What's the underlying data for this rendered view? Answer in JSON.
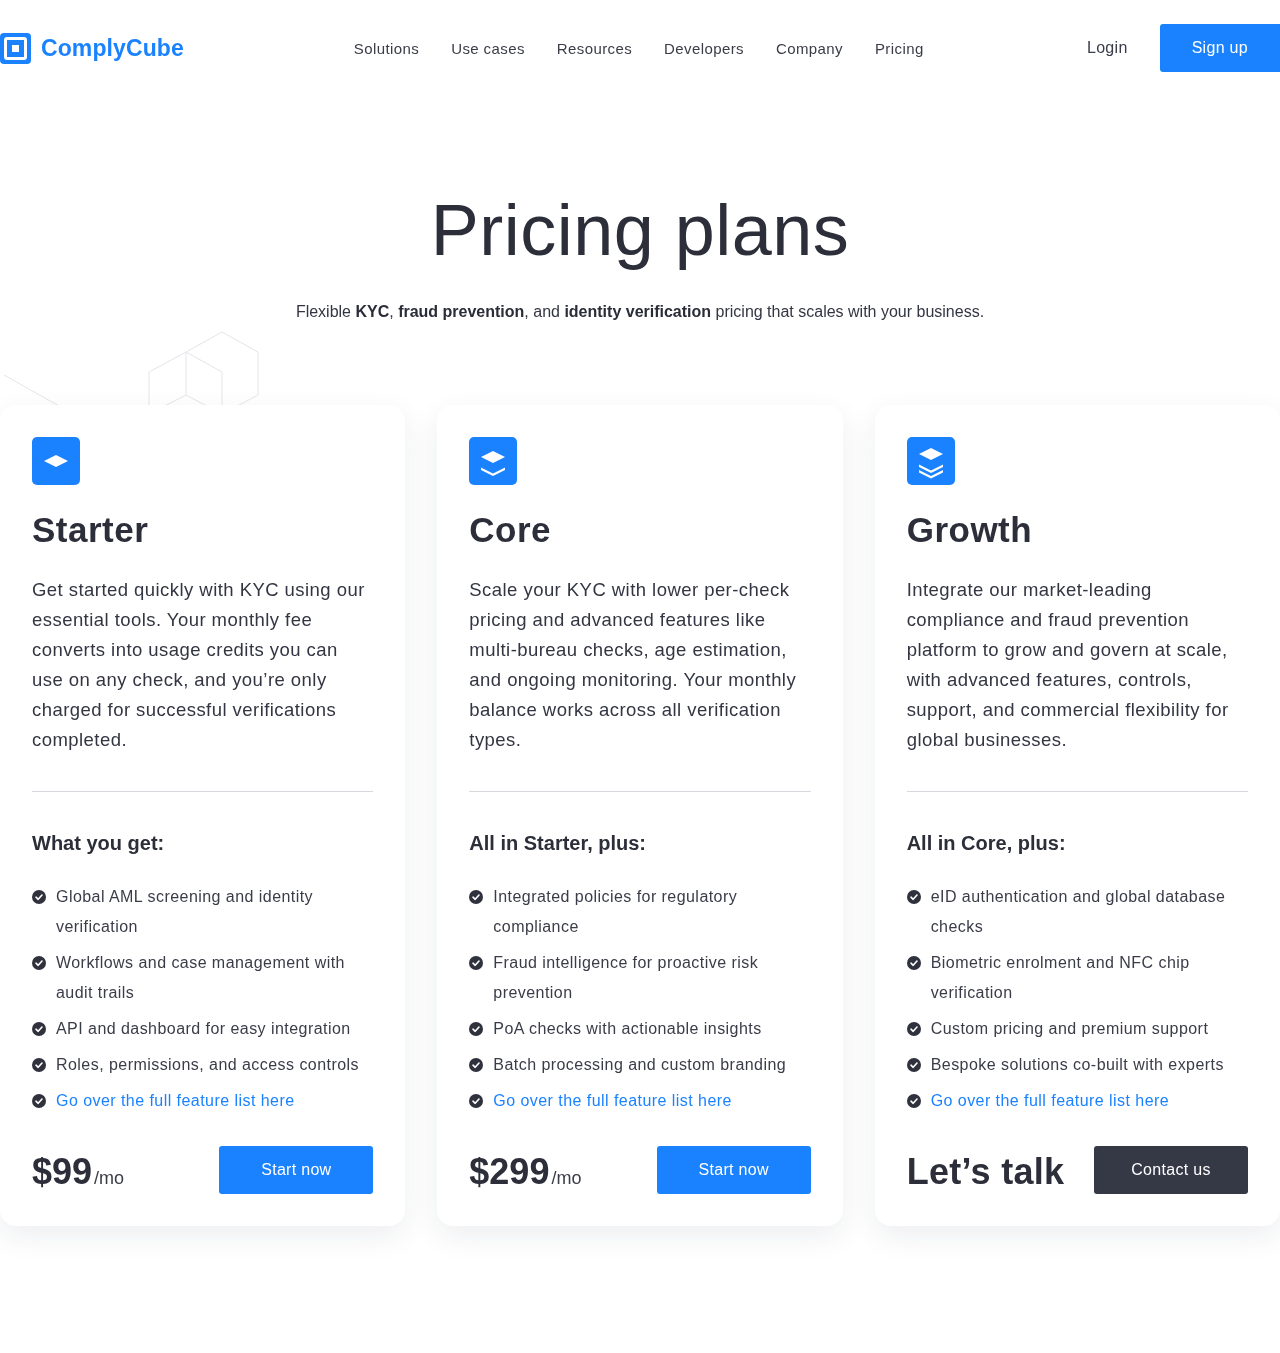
{
  "header": {
    "logo": "ComplyCube",
    "nav": [
      "Solutions",
      "Use cases",
      "Resources",
      "Developers",
      "Company",
      "Pricing"
    ],
    "login": "Login",
    "signup": "Sign up"
  },
  "hero": {
    "title": "Pricing plans",
    "subtitle": "Flexible **KYC**, **fraud prevention**, and **identity verification** pricing that scales with your business."
  },
  "plans": [
    {
      "icon": {
        "kind": "single"
      },
      "name": "Starter",
      "description": "Get started quickly with KYC using our essential tools. Your monthly fee converts into usage credits you can use on any check, and you’re only charged for successful verifications completed.",
      "features_heading": "What you get:",
      "features": [
        {
          "kind": "text",
          "text": "Global AML screening and identity verification"
        },
        {
          "kind": "text",
          "text": "Workflows and case management with audit trails"
        },
        {
          "kind": "text",
          "text": "API and dashboard for easy integration"
        },
        {
          "kind": "text",
          "text": "Roles, permissions, and access controls"
        },
        {
          "kind": "link",
          "text": "Go over the full feature list here"
        }
      ],
      "price": {
        "kind": "amount",
        "value": "$99",
        "unit": "/mo"
      },
      "button": {
        "kind": "primary",
        "label": "Start now"
      }
    },
    {
      "icon": {
        "kind": "double"
      },
      "name": "Core",
      "description": "Scale your KYC with lower per-check pricing and advanced features like multi-bureau checks, age estimation, and ongoing monitoring. Your monthly balance works across all verification types.",
      "features_heading": "All in Starter, plus:",
      "features": [
        {
          "kind": "text",
          "text": "Integrated policies for regulatory compliance"
        },
        {
          "kind": "text",
          "text": "Fraud intelligence for proactive risk prevention"
        },
        {
          "kind": "text",
          "text": "PoA checks with actionable insights"
        },
        {
          "kind": "text",
          "text": "Batch processing and custom branding"
        },
        {
          "kind": "link",
          "text": "Go over the full feature list here"
        }
      ],
      "price": {
        "kind": "amount",
        "value": "$299",
        "unit": "/mo"
      },
      "button": {
        "kind": "primary",
        "label": "Start now"
      }
    },
    {
      "icon": {
        "kind": "triple"
      },
      "name": "Growth",
      "description": "Integrate our market-leading compliance and fraud prevention platform to grow and govern at scale, with advanced features, controls, support, and commercial flexibility for global businesses.",
      "features_heading": "All in Core, plus:",
      "features": [
        {
          "kind": "text",
          "text": "eID authentication and global database checks"
        },
        {
          "kind": "text",
          "text": "Biometric enrolment and NFC chip verification"
        },
        {
          "kind": "text",
          "text": "Custom pricing and premium support"
        },
        {
          "kind": "text",
          "text": "Bespoke solutions co-built with experts"
        },
        {
          "kind": "link",
          "text": "Go over the full feature list here"
        }
      ],
      "price": {
        "kind": "quote",
        "value": "Let’s talk"
      },
      "button": {
        "kind": "dark",
        "label": "Contact us"
      }
    }
  ]
}
